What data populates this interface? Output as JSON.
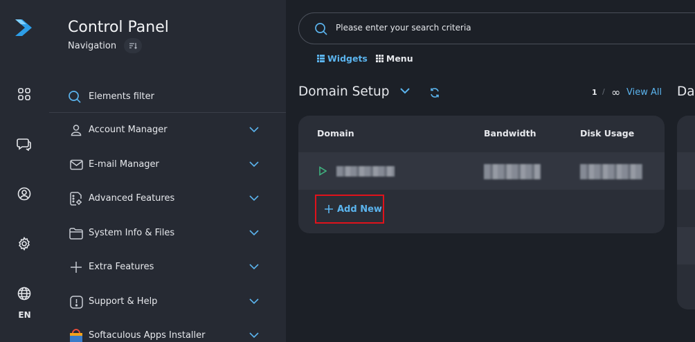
{
  "rail": {
    "items": [
      "widgets-grid",
      "chat",
      "profile",
      "settings",
      "language"
    ],
    "language": "EN"
  },
  "nav": {
    "title": "Control Panel",
    "subtitle": "Navigation",
    "filter_label": "Elements filter",
    "items": [
      {
        "label": "Account Manager",
        "icon": "user-icon"
      },
      {
        "label": "E-mail Manager",
        "icon": "mail-icon"
      },
      {
        "label": "Advanced Features",
        "icon": "document-gear-icon"
      },
      {
        "label": "System Info & Files",
        "icon": "folder-icon"
      },
      {
        "label": "Extra Features",
        "icon": "plus-icon"
      },
      {
        "label": "Support & Help",
        "icon": "alert-icon"
      },
      {
        "label": "Softaculous Apps Installer",
        "icon": "softaculous-icon"
      }
    ]
  },
  "search": {
    "placeholder": "Please enter your search criteria"
  },
  "view_tabs": {
    "widgets": "Widgets",
    "menu": "Menu"
  },
  "section": {
    "title": "Domain Setup",
    "page": "1",
    "page_sep": "/",
    "page_total": "∞",
    "view_all": "View All",
    "next_title": "Da"
  },
  "table": {
    "columns": [
      "Domain",
      "Bandwidth",
      "Disk Usage"
    ],
    "add_new": "Add New"
  },
  "colors": {
    "accent": "#5bb4ee",
    "highlight": "#e0121b",
    "play": "#3fb27f"
  }
}
